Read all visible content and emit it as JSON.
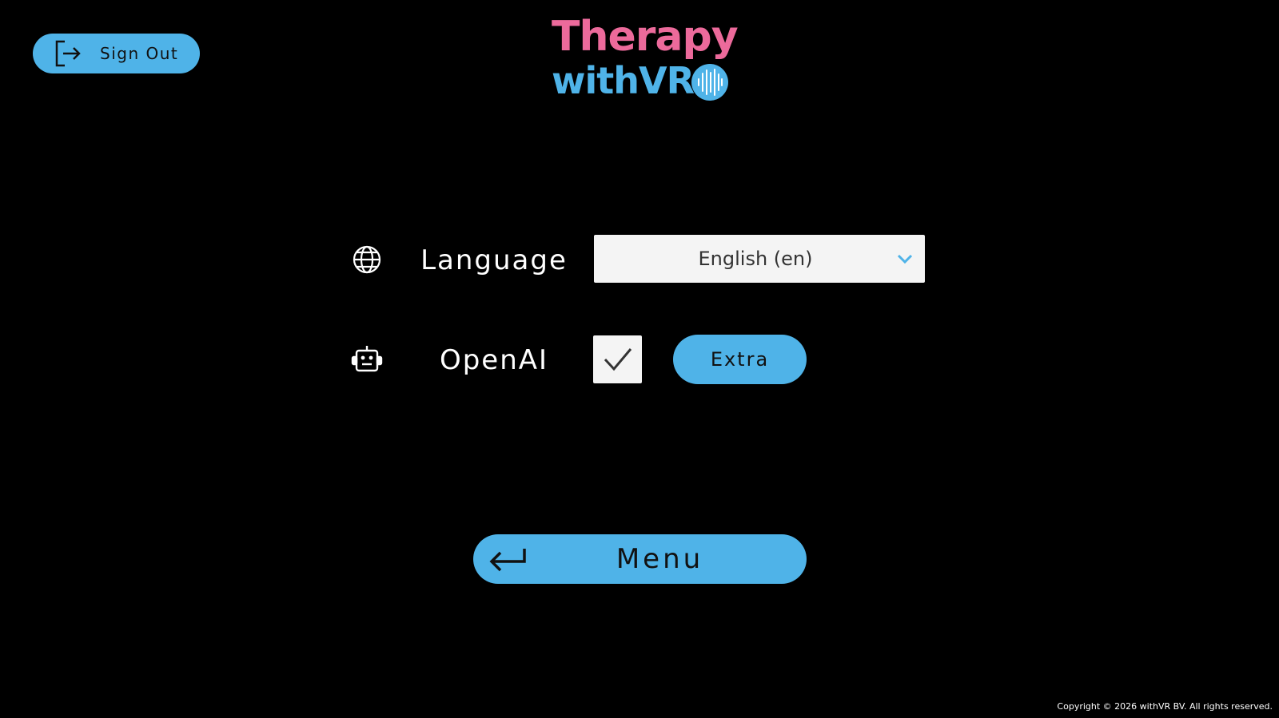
{
  "header": {
    "sign_out_label": "Sign Out",
    "logo": {
      "line1": "Therapy",
      "line2": "withVR",
      "color_primary": "#ec6a9b",
      "color_secondary": "#4fb3e8"
    }
  },
  "settings": {
    "language": {
      "icon": "globe-icon",
      "label": "Language",
      "selected": "English (en)"
    },
    "openai": {
      "icon": "robot-icon",
      "label": "OpenAI",
      "checked": true,
      "extra_label": "Extra"
    }
  },
  "footer": {
    "menu_label": "Menu",
    "copyright": "Copyright © 2026 withVR BV. All rights reserved."
  },
  "colors": {
    "background": "#000000",
    "accent": "#4fb3e8",
    "field": "#f4f4f4"
  }
}
